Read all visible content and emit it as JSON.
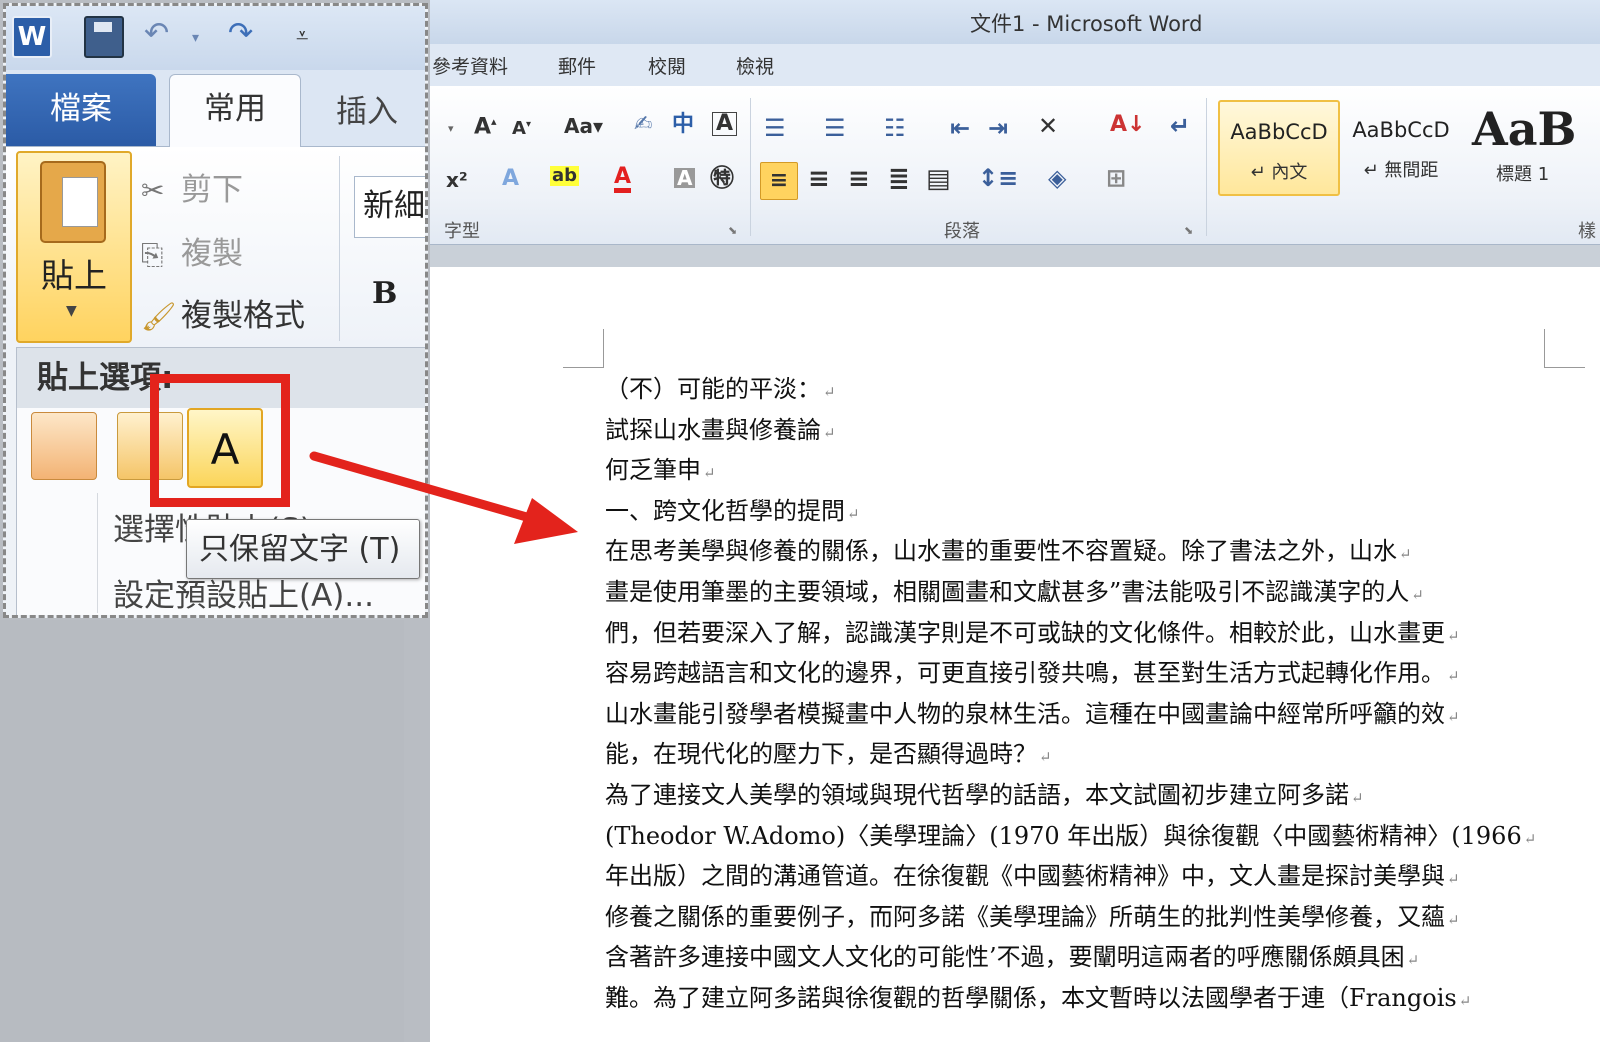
{
  "window": {
    "title": "文件1 - Microsoft Word"
  },
  "ribbon_tabs_bg": [
    "參考資料",
    "郵件",
    "校閱",
    "檢視"
  ],
  "zoom_tabs": {
    "file": "檔案",
    "home": "常用",
    "insert": "插入"
  },
  "clipboard": {
    "paste": "貼上",
    "cut": "剪下",
    "copy": "複製",
    "format_painter": "複製格式"
  },
  "font": {
    "name_partial": "新細"
  },
  "groups": {
    "font": "字型",
    "paragraph": "段落",
    "styles": "樣"
  },
  "styles": [
    {
      "sample": "AaBbCcD",
      "name": "↵ 內文"
    },
    {
      "sample": "AaBbCcD",
      "name": "↵ 無間距"
    },
    {
      "sample": "AaB",
      "name": "標題 1"
    }
  ],
  "paste_menu": {
    "header": "貼上選項:",
    "item1": "選擇性貼上(S)...",
    "item2": "設定預設貼上(A)...",
    "tooltip": "只保留文字 (T)"
  },
  "document": {
    "lines": [
      "（不）可能的平淡：",
      "試探山水畫與修養論",
      "何乏筆申",
      "一、跨文化哲學的提問",
      "在思考美學與修養的關係，山水畫的重要性不容置疑。除了書法之外，山水",
      "畫是使用筆墨的主要領域，相關圖畫和文獻甚多”書法能吸引不認識漢字的人",
      "們，但若要深入了解，認識漢字則是不可或缺的文化條件。相較於此，山水畫更",
      "容易跨越語言和文化的邊界，可更直接引發共鳴，甚至對生活方式起轉化作用。",
      "山水畫能引發學者模擬畫中人物的泉林生活。這種在中國畫論中經常所呼籲的效",
      "能，在現代化的壓力下，是否顯得過時？",
      "為了連接文人美學的領域與現代哲學的話語，本文試圖初步建立阿多諾",
      "(Theodor W.Adomo)〈美學理論〉(1970 年出版）與徐復觀〈中國藝術精神〉(1966",
      "年出版）之間的溝通管道。在徐復觀《中國藝術精神》中，文人畫是探討美學與",
      "修養之關係的重要例子，而阿多諾《美學理論》所萌生的批判性美學修養，又蘊",
      "含著許多連接中國文人文化的可能性’不過，要闡明這兩者的呼應關係頗具困",
      "難。為了建立阿多諾與徐復觀的哲學關係，本文暫時以法國學者于連（Frangois"
    ],
    "pilcrow": "↵"
  },
  "colors": {
    "highlight": "#e3231c",
    "file_tab": "#2b5ba6",
    "paste_gold": "#ffd35f"
  }
}
